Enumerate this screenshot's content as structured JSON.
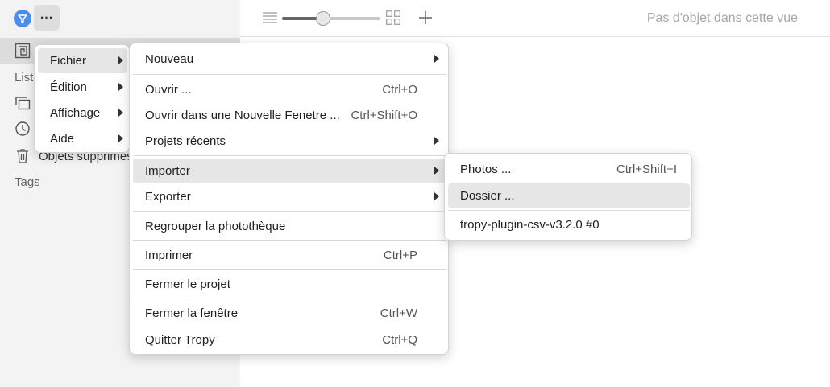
{
  "toolbar": {
    "status": "Pas d'objet dans cette vue",
    "zoom_level": 0.42
  },
  "sidebar": {
    "list_heading": "Listes",
    "deleted_label": "Objets supprimés",
    "tags_heading": "Tags",
    "accent": "#4a8ee8"
  },
  "menu_main": {
    "items": [
      {
        "label": "Fichier"
      },
      {
        "label": "Édition"
      },
      {
        "label": "Affichage"
      },
      {
        "label": "Aide"
      }
    ]
  },
  "menu_file": {
    "items": [
      {
        "label": "Nouveau",
        "accel": ""
      },
      {
        "label": "Ouvrir ...",
        "accel": "Ctrl+O"
      },
      {
        "label": "Ouvrir dans une Nouvelle Fenetre ...",
        "accel": "Ctrl+Shift+O"
      },
      {
        "label": "Projets récents",
        "accel": ""
      },
      {
        "label": "Importer",
        "accel": ""
      },
      {
        "label": "Exporter",
        "accel": ""
      },
      {
        "label": "Regrouper la photothèque",
        "accel": ""
      },
      {
        "label": "Imprimer",
        "accel": "Ctrl+P"
      },
      {
        "label": "Fermer le projet",
        "accel": ""
      },
      {
        "label": "Fermer la fenêtre",
        "accel": "Ctrl+W"
      },
      {
        "label": "Quitter Tropy",
        "accel": "Ctrl+Q"
      }
    ]
  },
  "menu_import": {
    "items": [
      {
        "label": "Photos ...",
        "accel": "Ctrl+Shift+I"
      },
      {
        "label": "Dossier ...",
        "accel": ""
      },
      {
        "label": "tropy-plugin-csv-v3.2.0 #0",
        "accel": ""
      }
    ]
  }
}
